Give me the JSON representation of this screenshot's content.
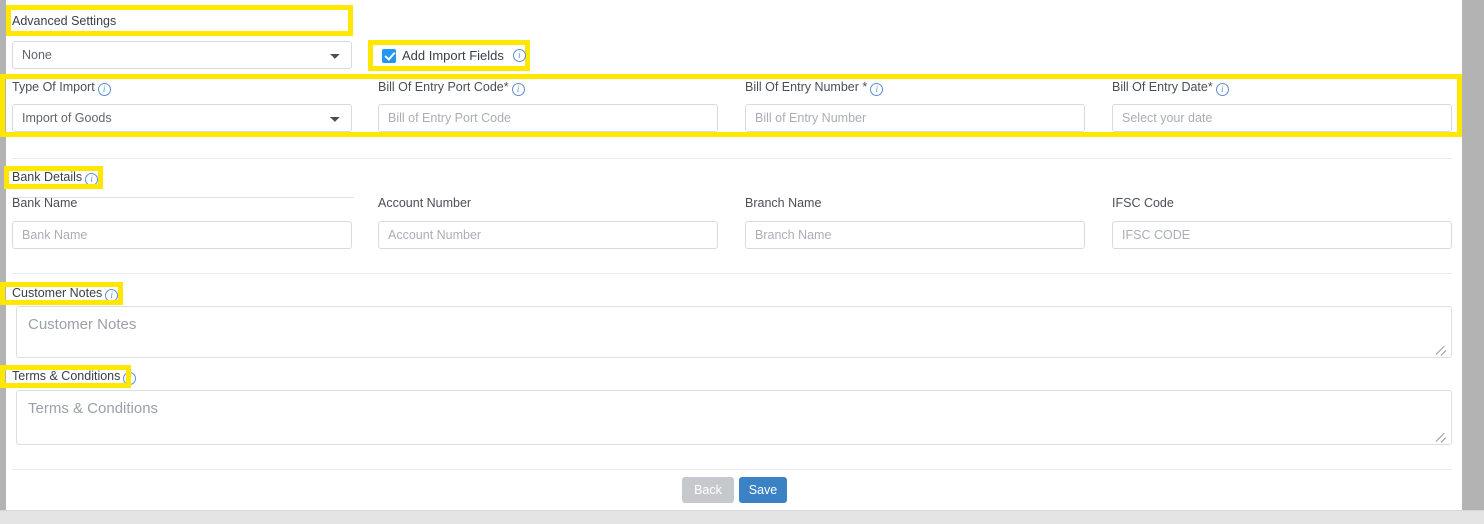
{
  "advanced": {
    "heading": "Advanced Settings",
    "select_value": "None",
    "select_options": [
      "None"
    ]
  },
  "import_toggle": {
    "label": "Add Import Fields",
    "checked": true,
    "info_icon": "info-icon"
  },
  "import_fields": [
    {
      "label": "Type Of Import",
      "required": false,
      "required_mark": "",
      "info_icon": "info-icon",
      "control": "select",
      "value": "Import of Goods",
      "options": [
        "Import of Goods"
      ],
      "placeholder": ""
    },
    {
      "label": "Bill Of Entry Port Code",
      "required": true,
      "required_mark": "*",
      "info_icon": "info-icon",
      "control": "text",
      "value": "",
      "placeholder": "Bill of Entry Port Code"
    },
    {
      "label": "Bill Of Entry Number ",
      "required": true,
      "required_mark": "*",
      "info_icon": "info-icon",
      "control": "text",
      "value": "",
      "placeholder": "Bill of Entry Number"
    },
    {
      "label": "Bill Of Entry Date",
      "required": true,
      "required_mark": "*",
      "info_icon": "info-icon",
      "control": "text",
      "value": "",
      "placeholder": "Select your date"
    }
  ],
  "bank_section": {
    "heading": "Bank Details",
    "info_icon": "info-icon",
    "fields": [
      {
        "label": "Bank Name",
        "value": "",
        "placeholder": "Bank Name"
      },
      {
        "label": "Account Number",
        "value": "",
        "placeholder": "Account Number"
      },
      {
        "label": "Branch Name",
        "value": "",
        "placeholder": "Branch Name"
      },
      {
        "label": "IFSC Code",
        "value": "",
        "placeholder": "IFSC CODE"
      }
    ]
  },
  "customer_notes": {
    "heading": "Customer Notes",
    "info_icon": "info-icon",
    "value": "",
    "placeholder": "Customer Notes"
  },
  "terms": {
    "heading": "Terms & Conditions",
    "info_icon": "info-icon",
    "value": "",
    "placeholder": "Terms & Conditions"
  },
  "footer": {
    "back_label": "Back",
    "save_label": "Save"
  },
  "colors": {
    "highlight": "#ffe700",
    "checkbox": "#2196f3",
    "save_button": "#3b82c4",
    "back_button": "#c5c9ce",
    "info_icon": "#5b8fd4",
    "page_background": "#b3b3b3",
    "sheet_background": "#ffffff"
  }
}
